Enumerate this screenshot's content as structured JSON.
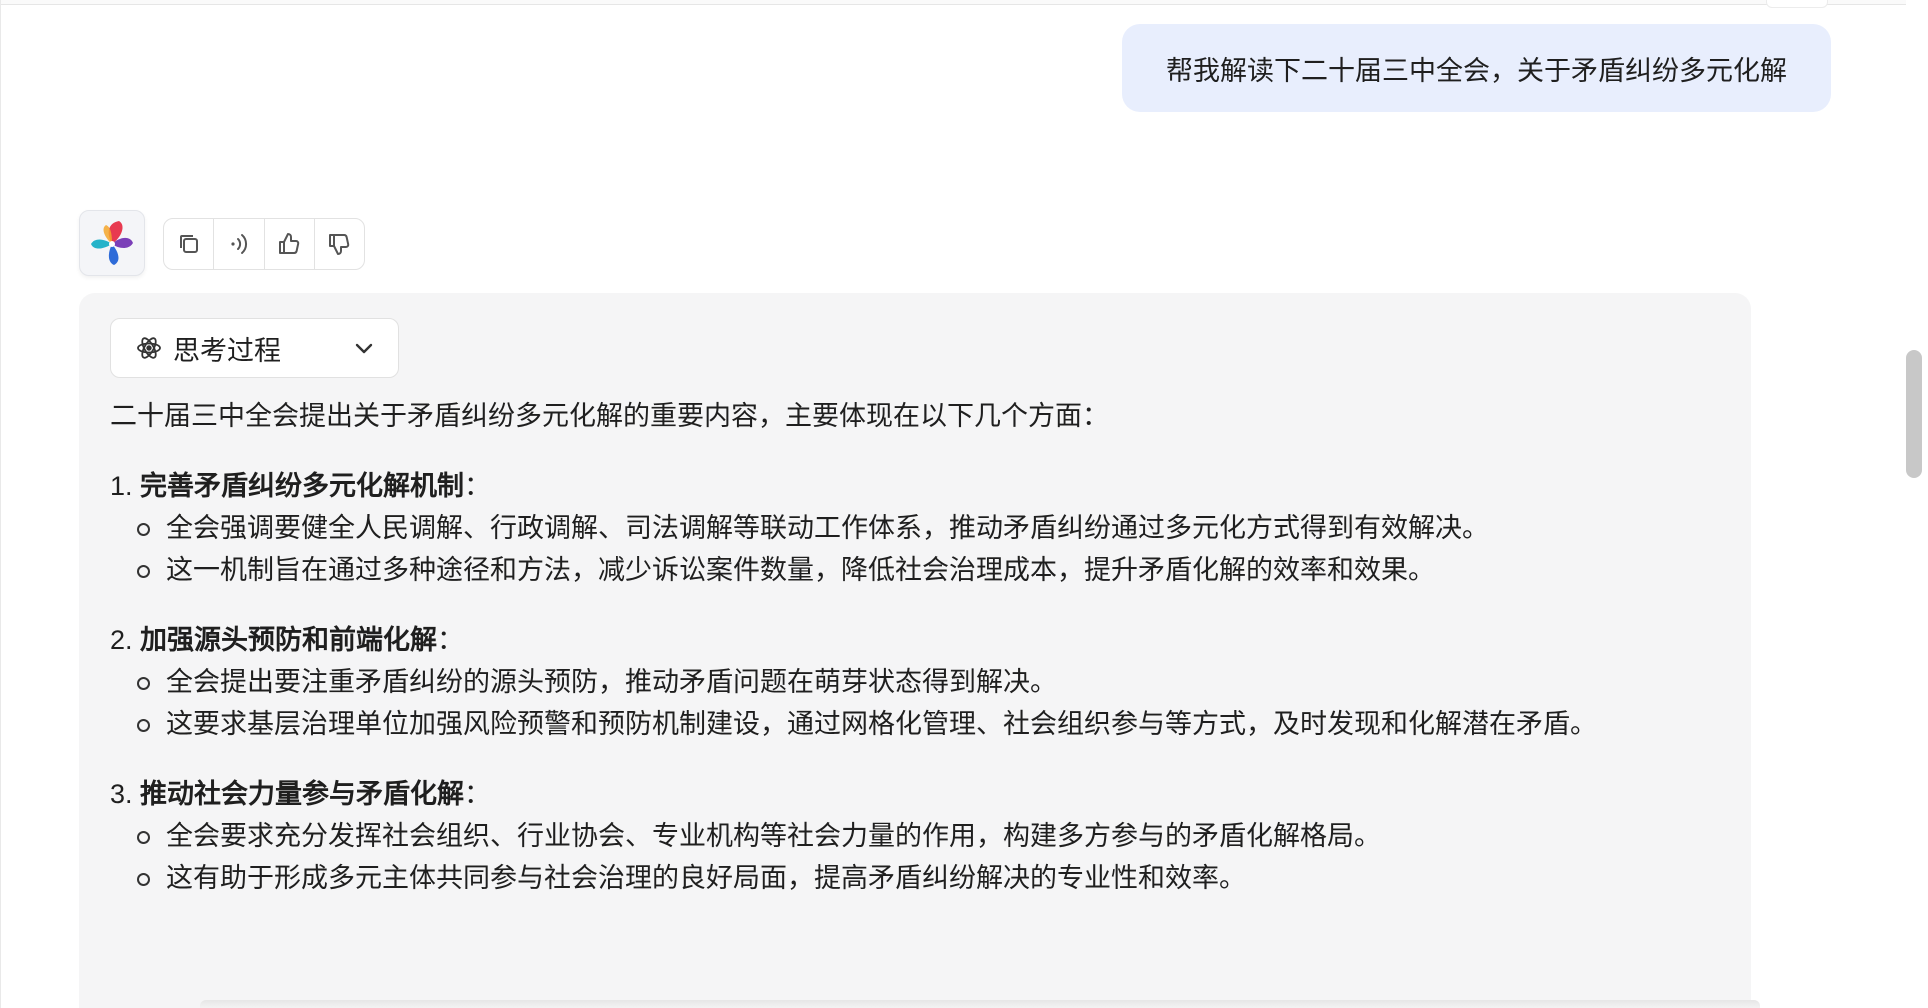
{
  "user_message": "帮我解读下二十届三中全会，关于矛盾纠纷多元化解",
  "actions": {
    "copy": "copy-icon",
    "read_aloud": "speaker-icon",
    "like": "thumbs-up-icon",
    "dislike": "thumbs-down-icon"
  },
  "thinking": {
    "label": "思考过程"
  },
  "answer": {
    "intro": "二十届三中全会提出关于矛盾纠纷多元化解的重要内容，主要体现在以下几个方面：",
    "sections": [
      {
        "num": "1. ",
        "title": "完善矛盾纠纷多元化解机制",
        "colon": "：",
        "bullets": [
          "全会强调要健全人民调解、行政调解、司法调解等联动工作体系，推动矛盾纠纷通过多元化方式得到有效解决。",
          "这一机制旨在通过多种途径和方法，减少诉讼案件数量，降低社会治理成本，提升矛盾化解的效率和效果。"
        ]
      },
      {
        "num": "2. ",
        "title": "加强源头预防和前端化解",
        "colon": "：",
        "bullets": [
          "全会提出要注重矛盾纠纷的源头预防，推动矛盾问题在萌芽状态得到解决。",
          "这要求基层治理单位加强风险预警和预防机制建设，通过网格化管理、社会组织参与等方式，及时发现和化解潜在矛盾。"
        ]
      },
      {
        "num": "3. ",
        "title": "推动社会力量参与矛盾化解",
        "colon": "：",
        "bullets": [
          "全会要求充分发挥社会组织、行业协会、专业机构等社会力量的作用，构建多方参与的矛盾化解格局。",
          "这有助于形成多元主体共同参与社会治理的良好局面，提高矛盾纠纷解决的专业性和效率。"
        ]
      }
    ]
  }
}
